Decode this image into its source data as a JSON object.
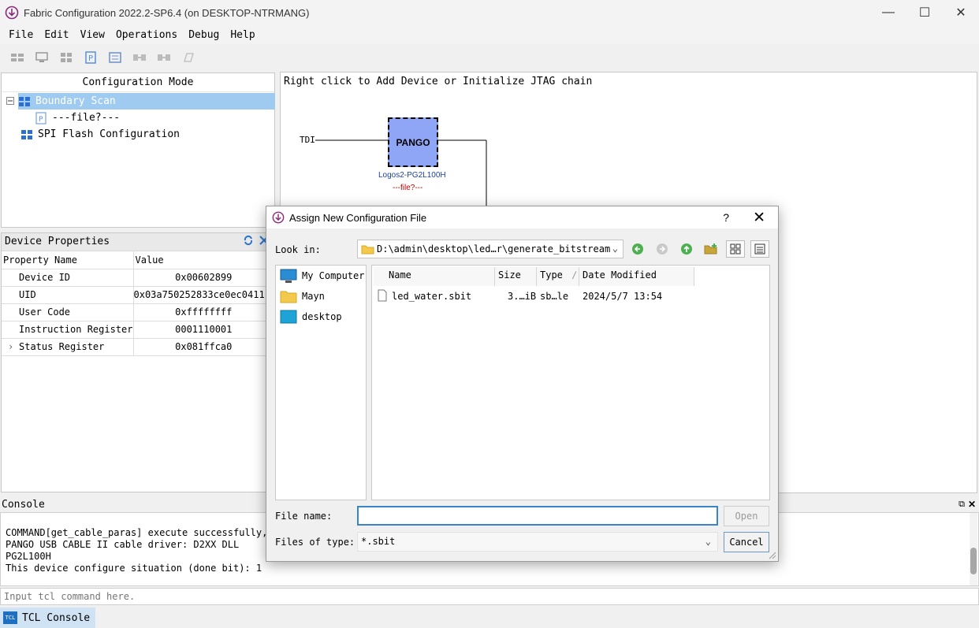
{
  "window": {
    "title": "Fabric Configuration 2022.2-SP6.4 (on DESKTOP-NTRMANG)"
  },
  "menu": [
    "File",
    "Edit",
    "View",
    "Operations",
    "Debug",
    "Help"
  ],
  "config_panel": {
    "title": "Configuration Mode",
    "items": [
      "Boundary Scan",
      "---file?---",
      "SPI Flash Configuration"
    ]
  },
  "device_properties": {
    "title": "Device Properties",
    "headers": [
      "Property Name",
      "Value"
    ],
    "rows": [
      {
        "name": "Device ID",
        "value": "0x00602899"
      },
      {
        "name": "UID",
        "value": "0x03a750252833ce0ec0411..."
      },
      {
        "name": "User Code",
        "value": "0xffffffff"
      },
      {
        "name": "Instruction Register",
        "value": "0001110001"
      },
      {
        "name": "Status Register",
        "value": "0x081ffca0"
      }
    ]
  },
  "canvas": {
    "hint": "Right click to Add Device or Initialize JTAG chain",
    "tdi_label": "TDI",
    "chip_label": "PANGO",
    "device_name": "Logos2-PG2L100H",
    "device_file": "---file?---"
  },
  "console": {
    "title": "Console",
    "lines": [
      "COMMAND[get_cable_paras] execute successfully,",
      "PANGO USB CABLE II cable driver: D2XX DLL",
      "PG2L100H",
      "This device configure situation (done bit): 1"
    ],
    "input_placeholder": "Input tcl command here.",
    "tab_label": "TCL Console",
    "tab_badge": "TCL"
  },
  "dialog": {
    "title": "Assign New Configuration File",
    "help": "?",
    "look_in_label": "Look in:",
    "look_in_value": "D:\\admin\\desktop\\led…r\\generate_bitstream",
    "sidebar": [
      "My Computer",
      "Mayn",
      "desktop"
    ],
    "columns": [
      "Name",
      "Size",
      "Type",
      "Date Modified"
    ],
    "files": [
      {
        "name": "led_water.sbit",
        "size": "3.…iB",
        "type": "sb…le",
        "date": "2024/5/7 13:54"
      }
    ],
    "file_name_label": "File name:",
    "file_name_value": "",
    "files_of_type_label": "Files of type:",
    "files_of_type_value": "*.sbit",
    "open_label": "Open",
    "cancel_label": "Cancel"
  },
  "colors": {
    "chip_fill": "#8fa6f6",
    "selection": "#9fcbf0",
    "device_name": "#1c3fa8",
    "device_file": "#c00000"
  }
}
